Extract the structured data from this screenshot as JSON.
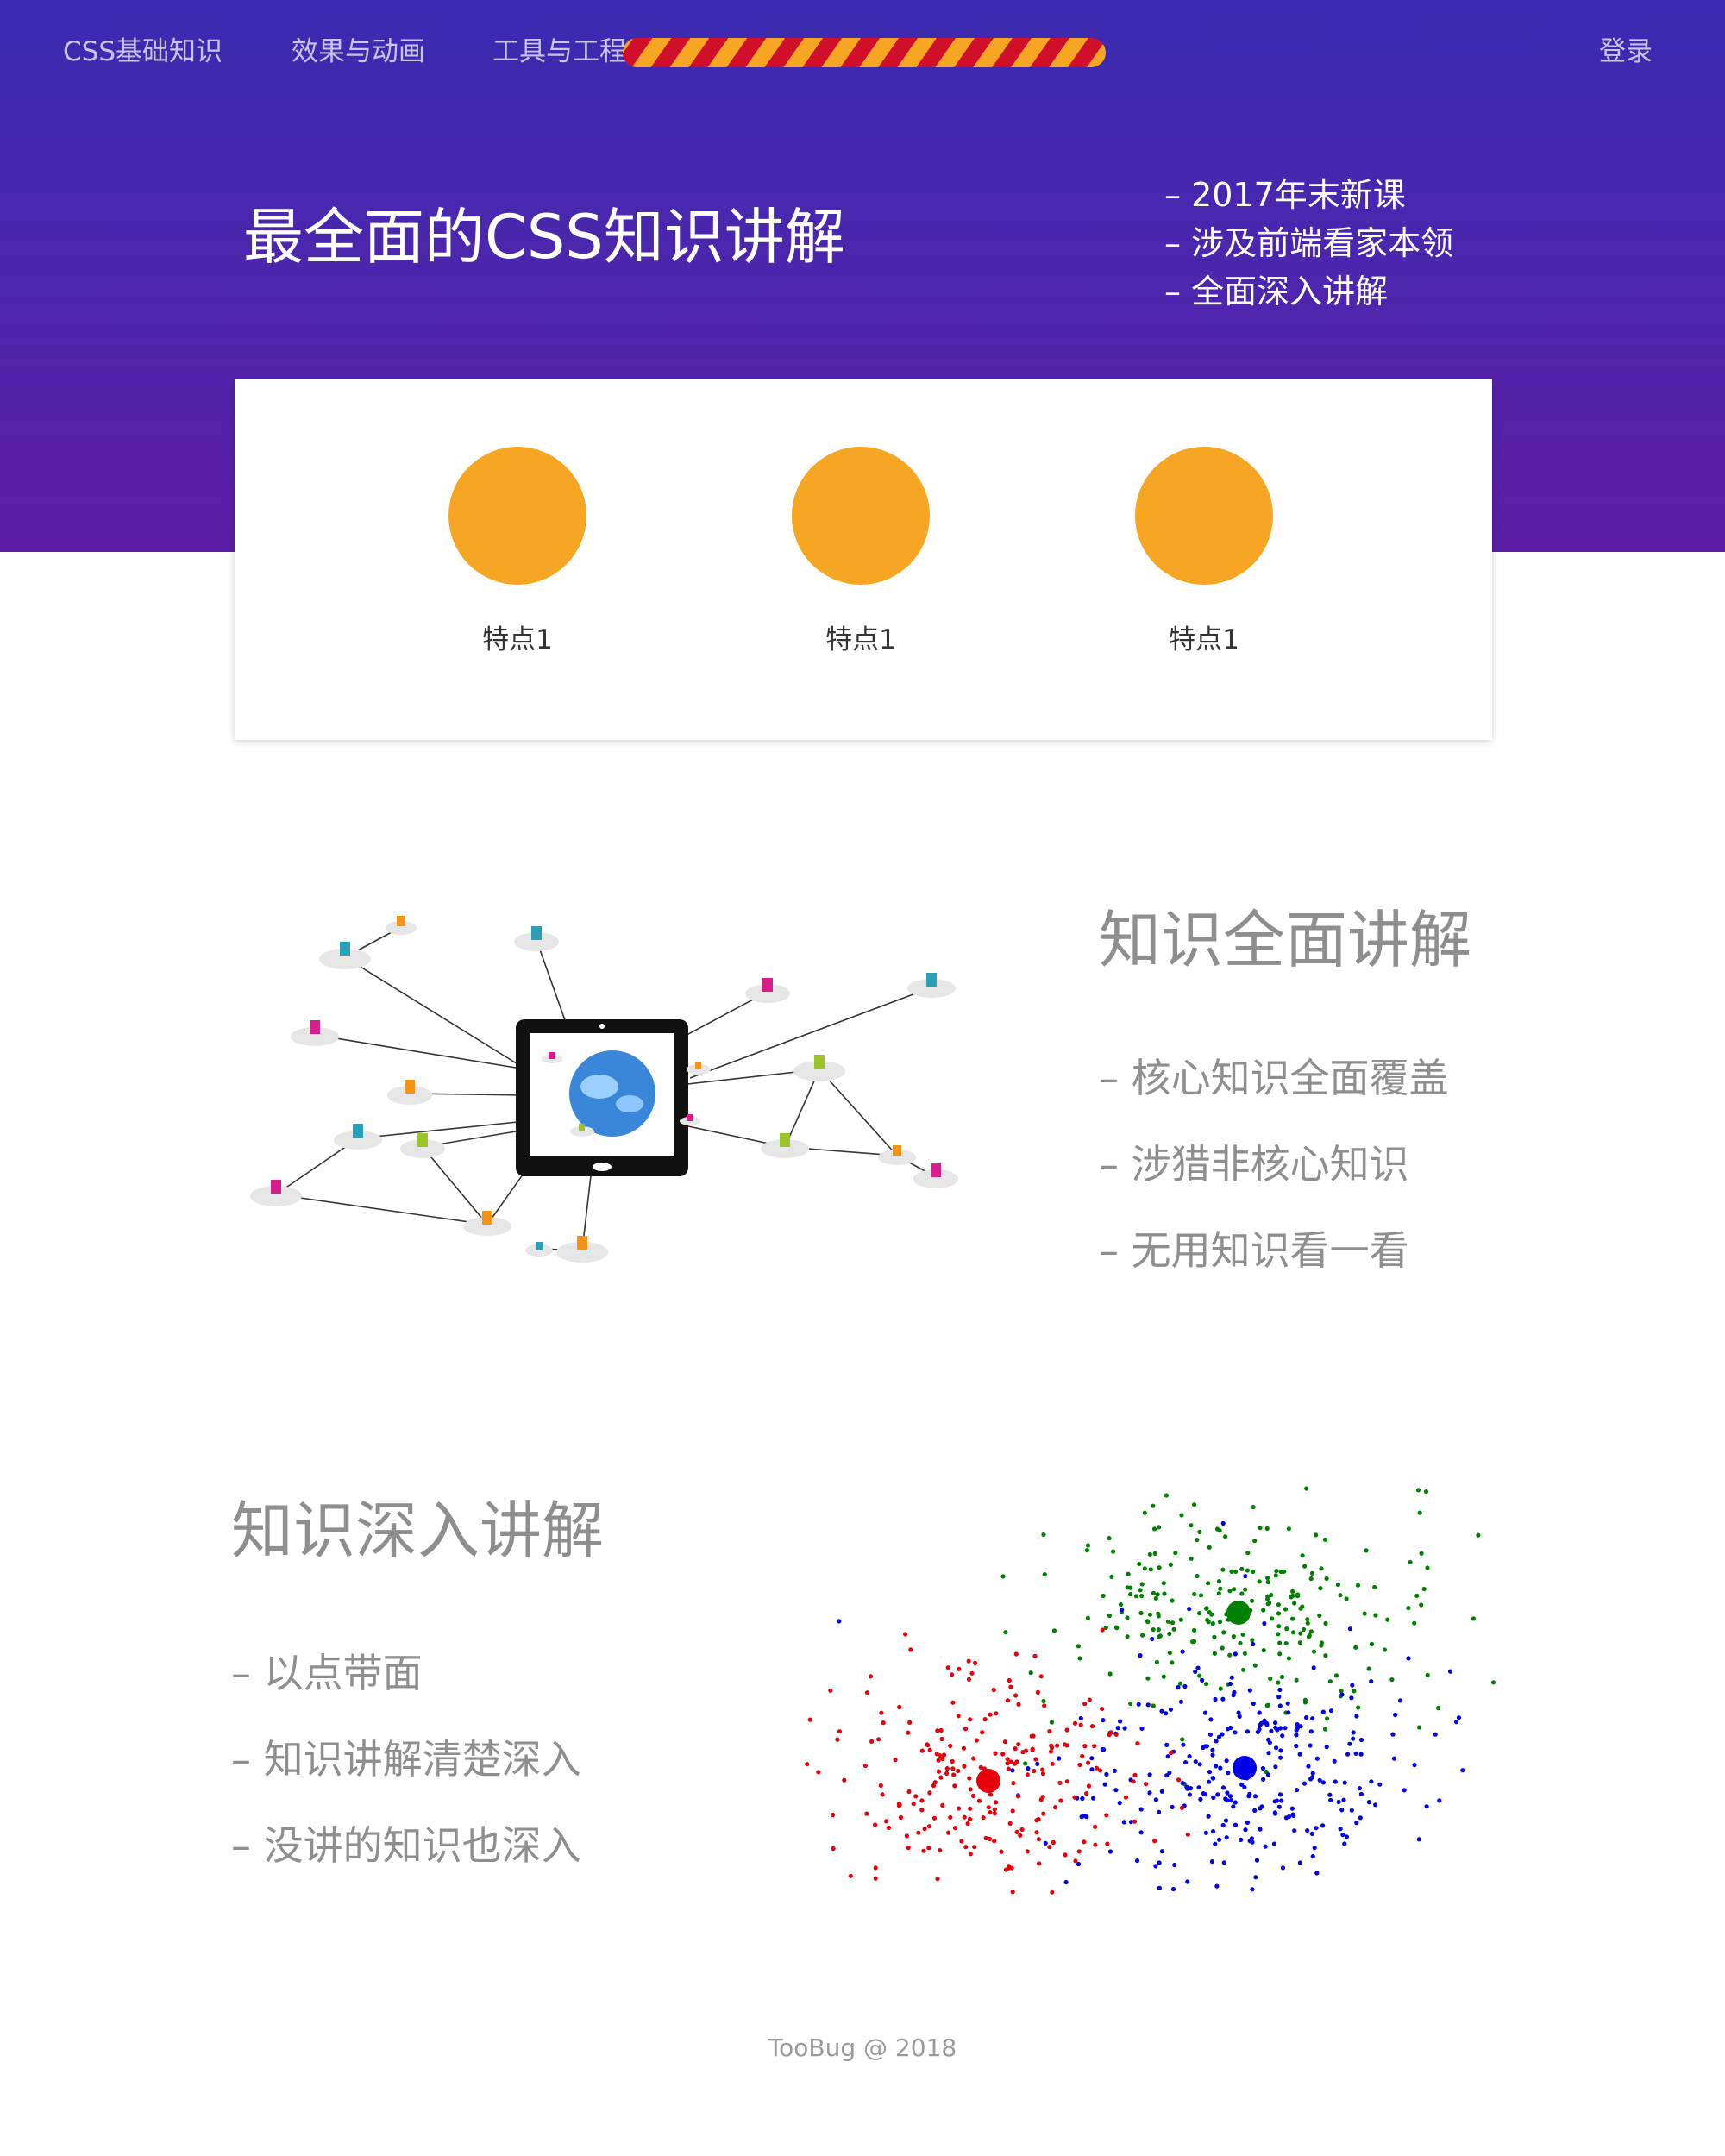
{
  "nav": {
    "items": [
      "CSS基础知识",
      "效果与动画",
      "工具与工程"
    ],
    "login": "登录"
  },
  "hero": {
    "title": "最全面的CSS知识讲解",
    "points": [
      "– 2017年末新课",
      "– 涉及前端看家本领",
      "– 全面深入讲解"
    ]
  },
  "features": [
    {
      "label": "特点1"
    },
    {
      "label": "特点1"
    },
    {
      "label": "特点1"
    }
  ],
  "section1": {
    "title": "知识全面讲解",
    "items": [
      "– 核心知识全面覆盖",
      "– 涉猎非核心知识",
      "– 无用知识看一看"
    ]
  },
  "section2": {
    "title": "知识深入讲解",
    "items": [
      "– 以点带面",
      "– 知识讲解清楚深入",
      "– 没讲的知识也深入"
    ]
  },
  "footer": {
    "text": "TooBug @ 2018"
  },
  "colors": {
    "hero_top": "#3b2bb0",
    "hero_bottom": "#5d1ea6",
    "accent": "#f6a623",
    "stripe_red": "#d0102b",
    "scatter_red": "#e8000b",
    "scatter_green": "#008000",
    "scatter_blue": "#0000e8"
  }
}
